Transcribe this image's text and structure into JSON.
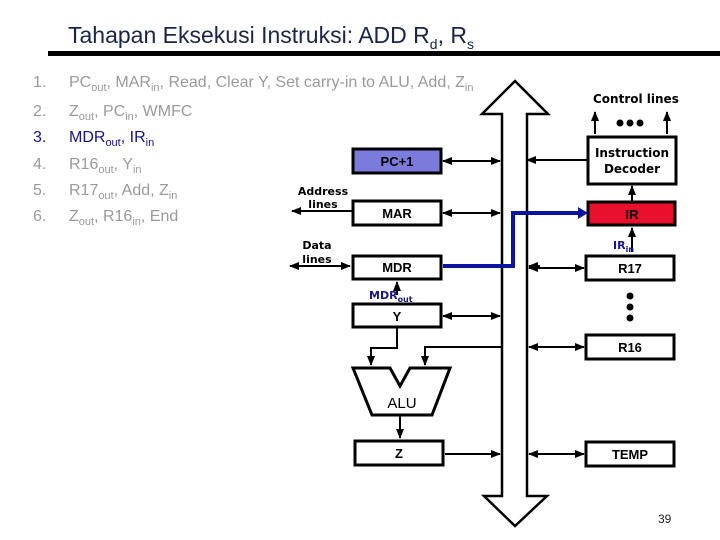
{
  "title": {
    "main": "Tahapan Eksekusi Instruksi: ADD R",
    "sub1": "d",
    "sep": ", R",
    "sub2": "s"
  },
  "steps": [
    {
      "num": "1.",
      "parts": [
        [
          "PC",
          ""
        ],
        [
          "out",
          "sub"
        ],
        [
          ", MAR",
          ""
        ],
        [
          "in",
          "sub"
        ],
        [
          ", Read, Clear Y, Set carry-in to ALU, Add, Z",
          ""
        ],
        [
          "in",
          "sub"
        ]
      ],
      "active": false
    },
    {
      "num": "2.",
      "parts": [
        [
          "Z",
          ""
        ],
        [
          "out",
          "sub"
        ],
        [
          ", PC",
          ""
        ],
        [
          "in",
          "sub"
        ],
        [
          ", WMFC",
          ""
        ]
      ],
      "active": false
    },
    {
      "num": "3.",
      "parts": [
        [
          "MDR",
          ""
        ],
        [
          "out",
          "sub"
        ],
        [
          ", IR",
          ""
        ],
        [
          "in",
          "sub"
        ]
      ],
      "active": true
    },
    {
      "num": "4.",
      "parts": [
        [
          "R16",
          ""
        ],
        [
          "out",
          "sub"
        ],
        [
          ", Y",
          ""
        ],
        [
          "in",
          "sub"
        ]
      ],
      "active": false
    },
    {
      "num": "5.",
      "parts": [
        [
          "R17",
          ""
        ],
        [
          "out",
          "sub"
        ],
        [
          ", Add, Z",
          ""
        ],
        [
          "in",
          "sub"
        ]
      ],
      "active": false
    },
    {
      "num": "6.",
      "parts": [
        [
          "Z",
          ""
        ],
        [
          "out",
          "sub"
        ],
        [
          ", R16",
          ""
        ],
        [
          "in",
          "sub"
        ],
        [
          ", End",
          ""
        ]
      ],
      "active": false
    }
  ],
  "diagram": {
    "control_lines_label": "Control lines",
    "decoder_label_line1": "Instruction",
    "decoder_label_line2": "Decoder",
    "address_lines_line1": "Address",
    "address_lines_line2": "lines",
    "data_lines_line1": "Data",
    "data_lines_line2": "lines",
    "registers": {
      "pc_plus_1": "PC+1",
      "mar": "MAR",
      "mdr": "MDR",
      "y": "Y",
      "ir": "IR",
      "r17": "R17",
      "r16": "R16",
      "temp": "TEMP",
      "z": "Z",
      "alu": "ALU"
    },
    "signals": {
      "mdr_out_main": "MDR",
      "mdr_out_sub": "out",
      "ir_in_main": "IR",
      "ir_in_sub": "in"
    },
    "colors": {
      "pc_fill": "#7b7bdc",
      "ir_fill": "#e8102c",
      "active_path": "#0a14a0",
      "signal_text": "#14148c"
    }
  },
  "page_number": "39"
}
